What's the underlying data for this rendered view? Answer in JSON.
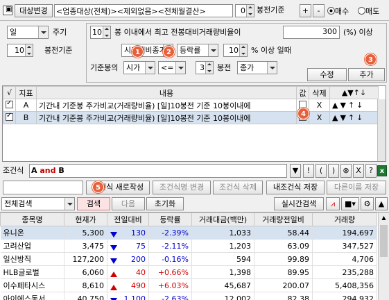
{
  "top": {
    "target_label": "대상변경",
    "target_value": "<업종대상(전체)><제외없음><전체월결산>",
    "bong_value": "0",
    "bong_label": "봉전기준",
    "plus": "+",
    "minus": "-",
    "buy_label": "매수",
    "sell_label": "매도"
  },
  "left": {
    "period_value": "일",
    "period_label": "주기",
    "base_value": "10",
    "base_label": "봉전기준"
  },
  "cond": {
    "n_value": "10",
    "text1": "봉 이내에서 최고 전봉대비거래량비율이",
    "ratio_value": "300",
    "text2": "(%) 이상",
    "field1": "시가대비종가",
    "field2": "등락률",
    "pct_value": "10",
    "text3": "% 이상 일때",
    "base_label": "기준봉의",
    "open": "시가",
    "op": "<=",
    "n2_value": "3",
    "text4": "봉전",
    "close": "종가",
    "edit_btn": "수정",
    "add_btn": "추가"
  },
  "indicators": {
    "headers": [
      "√",
      "지표",
      "내용",
      "값",
      "삭제",
      "▲▼↑↓"
    ],
    "rows": [
      {
        "check": true,
        "id": "A",
        "content": "기간내 기준봉 주가비교(거래량비율) [일]10봉전 기준 10봉이내에",
        "value": "",
        "delete": "X"
      },
      {
        "check": true,
        "id": "B",
        "content": "기간내 기준봉 주가비교(거래량비율) [일]10봉전 기준 10봉이내에",
        "value": "",
        "delete": "X"
      }
    ]
  },
  "formula": {
    "label": "조건식",
    "value_a": "A",
    "value_and": "and",
    "value_b": "B",
    "ops": [
      "▼",
      "!",
      "(",
      ")",
      "⊗",
      "X",
      "?"
    ]
  },
  "actions": {
    "new": "조건식 새로작성",
    "rename": "조건식명 변경",
    "delete": "조건식 삭제",
    "save_mine": "내조건식 저장",
    "save_as": "다른이름 저장"
  },
  "search": {
    "scope": "전체검색",
    "search_btn": "검색",
    "next_btn": "다음",
    "reset_btn": "초기화",
    "realtime_btn": "실시간검색"
  },
  "results": {
    "headers": [
      "종목명",
      "현재가",
      "전일대비",
      "등락률",
      "거래대금(백만)",
      "거래량전일비",
      "거래량"
    ],
    "rows": [
      {
        "name": "유니온",
        "price": "5,300",
        "dir": "down",
        "change": "130",
        "rate": "-2.39%",
        "amount": "1,033",
        "vol_ratio": "58.44",
        "volume": "194,697"
      },
      {
        "name": "고려산업",
        "price": "3,475",
        "dir": "down",
        "change": "75",
        "rate": "-2.11%",
        "amount": "1,203",
        "vol_ratio": "63.09",
        "volume": "347,527"
      },
      {
        "name": "일신방직",
        "price": "127,200",
        "dir": "down",
        "change": "200",
        "rate": "-0.16%",
        "amount": "594",
        "vol_ratio": "99.89",
        "volume": "4,706"
      },
      {
        "name": "HLB글로벌",
        "price": "6,060",
        "dir": "up",
        "change": "40",
        "rate": "+0.66%",
        "amount": "1,398",
        "vol_ratio": "89.95",
        "volume": "235,288"
      },
      {
        "name": "이수페타시스",
        "price": "8,610",
        "dir": "up",
        "change": "490",
        "rate": "+6.03%",
        "amount": "45,687",
        "vol_ratio": "200.07",
        "volume": "5,408,356"
      },
      {
        "name": "아이에스동서",
        "price": "40,750",
        "dir": "down",
        "change": "1,100",
        "rate": "-2.63%",
        "amount": "12,002",
        "vol_ratio": "82.38",
        "volume": "294,932"
      }
    ]
  },
  "badges": [
    "1",
    "2",
    "3",
    "4",
    "5"
  ]
}
